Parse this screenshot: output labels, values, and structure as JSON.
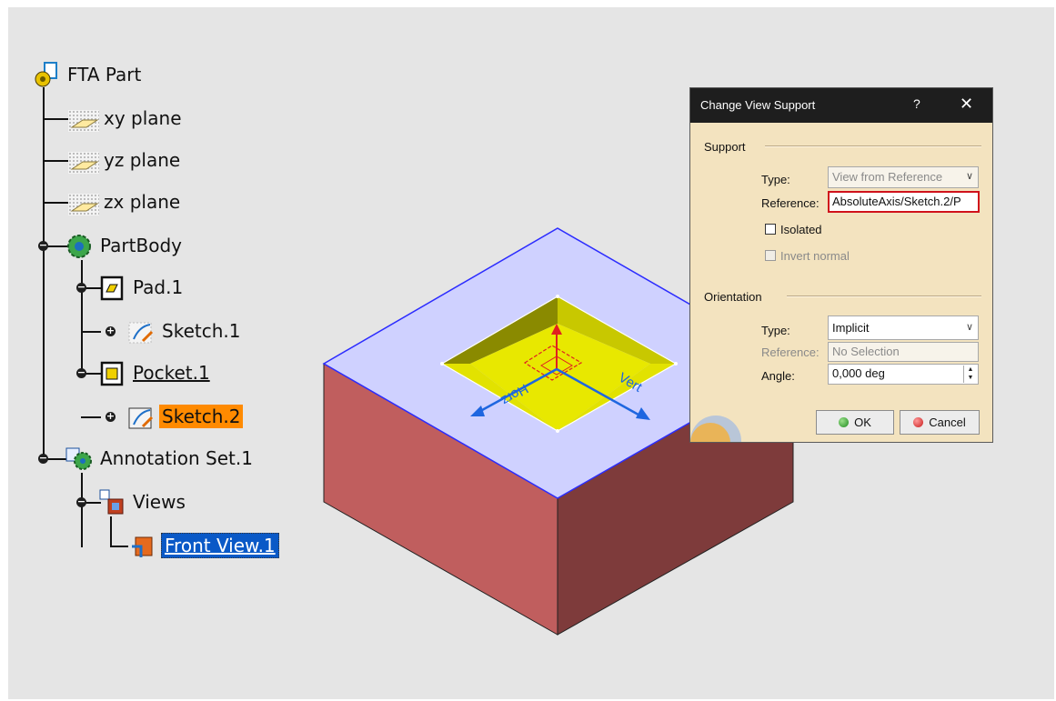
{
  "tree": {
    "root": "FTA Part",
    "xy_plane": "xy plane",
    "yz_plane": "yz plane",
    "zx_plane": "zx plane",
    "partbody": "PartBody",
    "pad": "Pad.1",
    "sketch1": "Sketch.1",
    "pocket": "Pocket.1",
    "sketch2": "Sketch.2",
    "annotation_set": "Annotation Set.1",
    "views": "Views",
    "front_view": "Front View.1"
  },
  "viewport": {
    "horz_label": "Horz",
    "vert_label": "Vert",
    "colors": {
      "top_face": "#cfd1ff",
      "left_face": "#c05e5e",
      "right_face": "#7e3b3b",
      "pocket": "#e8e800",
      "edge": "#2c2cff"
    }
  },
  "dialog": {
    "title": "Change View Support",
    "help": "?",
    "close": "✕",
    "support_group": "Support",
    "type_label": "Type:",
    "type_value": "View from Reference",
    "reference_label": "Reference:",
    "reference_value": "AbsoluteAxis/Sketch.2/P",
    "isolated_label": "Isolated",
    "invert_normal_label": "Invert normal",
    "orientation_group": "Orientation",
    "orient_type_label": "Type:",
    "orient_type_value": "Implicit",
    "orient_reference_label": "Reference:",
    "orient_reference_value": "No Selection",
    "angle_label": "Angle:",
    "angle_value": "0,000 deg",
    "ok_label": "OK",
    "cancel_label": "Cancel"
  }
}
